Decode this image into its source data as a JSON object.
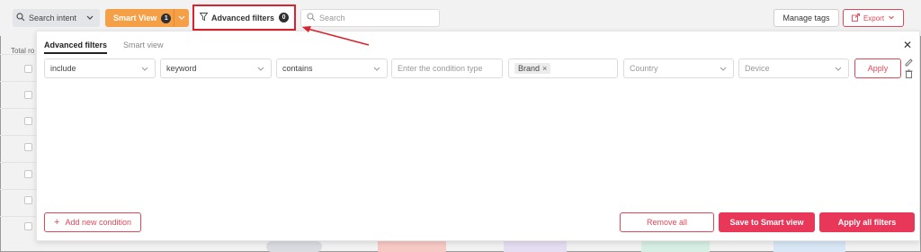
{
  "toolbar": {
    "search_intent_label": "Search intent",
    "smart_view_label": "Smart View",
    "smart_view_count": "1",
    "advanced_filters_label": "Advanced filters",
    "advanced_filters_count": "0",
    "search_placeholder": "Search",
    "manage_tags_label": "Manage tags",
    "export_label": "Export"
  },
  "background": {
    "total_label": "Total ro"
  },
  "panel": {
    "tabs": [
      {
        "label": "Advanced filters",
        "active": true
      },
      {
        "label": "Smart view",
        "active": false
      }
    ],
    "condition": {
      "operator": "include",
      "field": "keyword",
      "match": "contains",
      "value_placeholder": "Enter the condition type",
      "tag": "Brand",
      "country_placeholder": "Country",
      "device_placeholder": "Device",
      "apply_label": "Apply"
    },
    "footer": {
      "add_condition_label": "Add new condition",
      "remove_all_label": "Remove all",
      "save_smart_view_label": "Save to Smart view",
      "apply_all_label": "Apply all filters"
    }
  },
  "colors": {
    "accent": "#e83758",
    "smart_view": "#f5a047",
    "highlight_border": "#d9232e",
    "arrow": "#d9232e"
  },
  "icons": {
    "search_intent": "search-icon",
    "filter": "funnel-icon",
    "search": "search-icon",
    "export": "export-icon",
    "close": "close-icon",
    "edit": "pencil-icon",
    "delete": "trash-icon",
    "add": "plus-icon"
  }
}
